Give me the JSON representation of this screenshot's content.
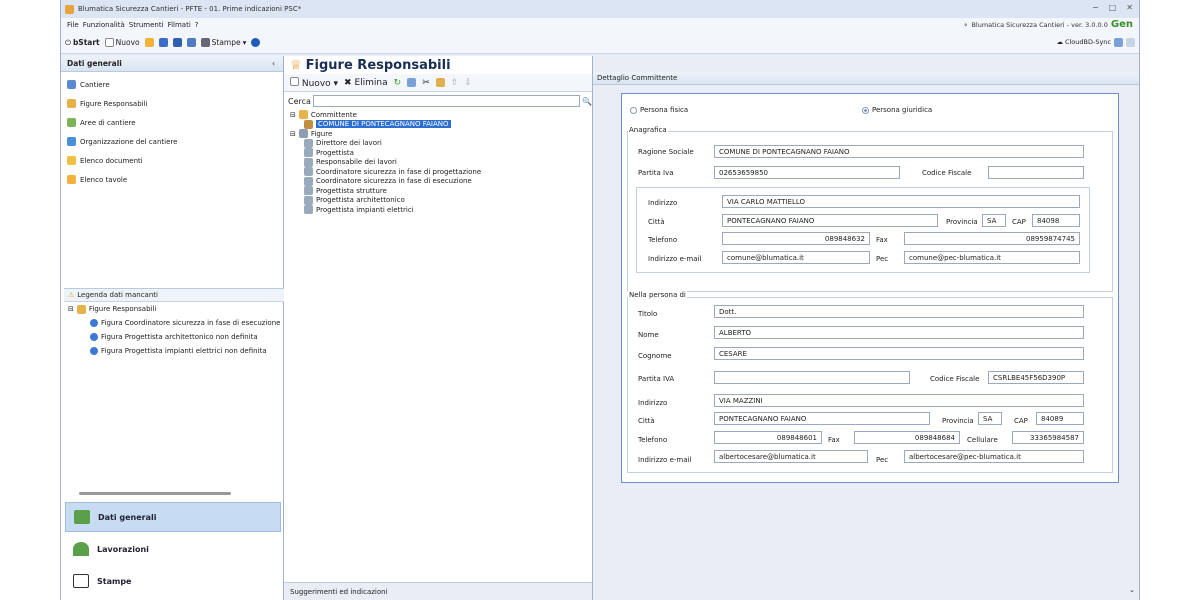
{
  "window": {
    "title": "Blumatica Sicurezza Cantieri - PFTE - 01. Prime indicazioni PSC*"
  },
  "menu": {
    "items": [
      "File",
      "Funzionalità",
      "Strumenti",
      "Filmati",
      "?"
    ],
    "version": "Blumatica Sicurezza Cantieri - ver. 3.0.0.0",
    "brand": "Gen"
  },
  "toolbar": {
    "bstart": "bStart",
    "nuovo": "Nuovo",
    "stampe": "Stampe",
    "cloud": "CloudBD-Sync"
  },
  "sidebar": {
    "title": "Dati generali",
    "items": [
      "Cantiere",
      "Figure Responsabili",
      "Aree di cantiere",
      "Organizzazione del cantiere",
      "Elenco documenti",
      "Elenco tavole"
    ],
    "legend_title": "Legenda dati mancanti",
    "legend_root": "Figure Responsabili",
    "legend_items": [
      "Figura Coordinatore sicurezza in fase di esecuzione",
      "Figura Progettista architettonico non definita",
      "Figura Progettista impianti elettrici non definita"
    ],
    "buttons": [
      "Dati generali",
      "Lavorazioni",
      "Stampe"
    ]
  },
  "middle": {
    "title": "Figure Responsabili",
    "tool_nuovo": "Nuovo",
    "tool_elimina": "Elimina",
    "search_label": "Cerca",
    "tree_committente": "Committente",
    "tree_comune": "COMUNE DI PONTECAGNANO FAIANO",
    "tree_figure": "Figure",
    "figures": [
      "Direttore dei lavori",
      "Progettista",
      "Responsabile dei lavori",
      "Coordinatore sicurezza in fase di progettazione",
      "Coordinatore sicurezza in fase di esecuzione",
      "Progettista strutture",
      "Progettista architettonico",
      "Progettista impianti elettrici"
    ],
    "suggestions": "Suggerimenti ed indicazioni"
  },
  "detail": {
    "header": "Dettaglio Committente",
    "radio_fisica": "Persona fisica",
    "radio_giuridica": "Persona giuridica",
    "anagrafica": "Anagrafica",
    "labels": {
      "ragione_sociale": "Ragione Sociale",
      "partita_iva": "Partita Iva",
      "codice_fiscale": "Codice Fiscale",
      "indirizzo": "Indirizzo",
      "citta": "Città",
      "provincia": "Provincia",
      "cap": "CAP",
      "telefono": "Telefono",
      "fax": "Fax",
      "email": "Indirizzo e-mail",
      "pec": "Pec"
    },
    "values": {
      "ragione_sociale": "COMUNE DI PONTECAGNANO FAIANO",
      "partita_iva": "02653659850",
      "codice_fiscale": "",
      "indirizzo": "VIA CARLO MATTIELLO",
      "citta": "PONTECAGNANO FAIANO",
      "provincia": "SA",
      "cap": "84098",
      "telefono": "089848632",
      "fax": "08959874745",
      "email": "comune@blumatica.it",
      "pec": "comune@pec-blumatica.it"
    },
    "persona": {
      "title": "Nella persona di",
      "labels": {
        "titolo": "Titolo",
        "nome": "Nome",
        "cognome": "Cognome",
        "piva": "Partita IVA",
        "cf": "Codice Fiscale",
        "indirizzo": "Indirizzo",
        "citta": "Città",
        "provincia": "Provincia",
        "cap": "CAP",
        "telefono": "Telefono",
        "fax": "Fax",
        "cellulare": "Cellulare",
        "email": "Indirizzo e-mail",
        "pec": "Pec"
      },
      "values": {
        "titolo": "Dott.",
        "nome": "ALBERTO",
        "cognome": "CESARE",
        "piva": "",
        "cf": "CSRLBE45F56D390P",
        "indirizzo": "VIA MAZZINI",
        "citta": "PONTECAGNANO FAIANO",
        "provincia": "SA",
        "cap": "84089",
        "telefono": "089848601",
        "fax": "089848684",
        "cellulare": "33365984587",
        "email": "albertocesare@blumatica.it",
        "pec": "albertocesare@pec-blumatica.it"
      }
    }
  }
}
